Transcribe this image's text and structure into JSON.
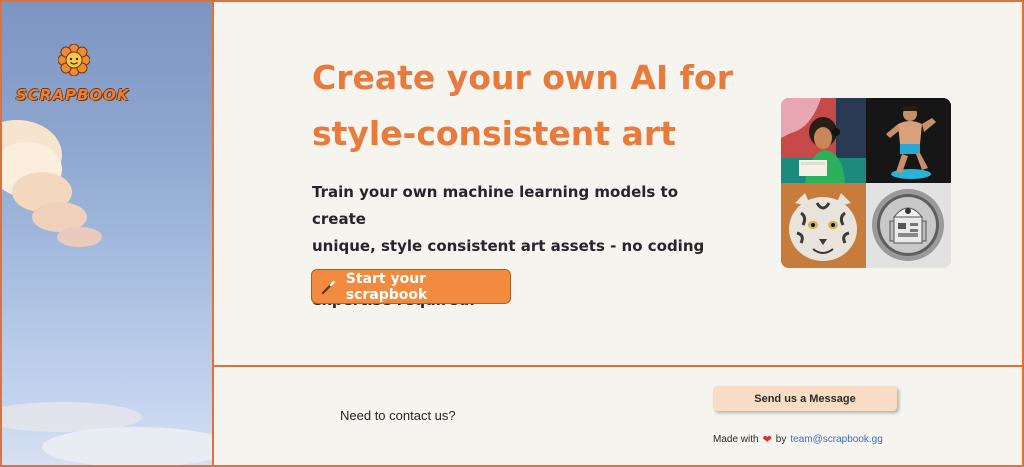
{
  "brand": {
    "logo_text": "SCRAPBOOK",
    "accent_color": "#e87a3c",
    "border_color": "#e46f37"
  },
  "hero": {
    "headline_line1": "Create your own AI for",
    "headline_line2": "style-consistent art",
    "subtext_line1": "Train your own machine learning models to create",
    "subtext_line2": "unique, style consistent art assets - no coding or",
    "subtext_line3": "expertise required.",
    "cta_label": "Start your scrapbook",
    "cta_icon": "magic-wand-icon",
    "cta_color": "#f28a3f"
  },
  "gallery": {
    "images": [
      "girl-at-desk-art",
      "papercraft-figure-art",
      "tiger-papercraft-art",
      "robot-coin-art"
    ]
  },
  "footer": {
    "contact_prompt": "Need to contact us?",
    "message_button": "Send us a Message",
    "made_with_prefix": "Made with",
    "made_with_icon": "heart-icon",
    "made_with_by": "by",
    "email": "team@scrapbook.gg"
  }
}
